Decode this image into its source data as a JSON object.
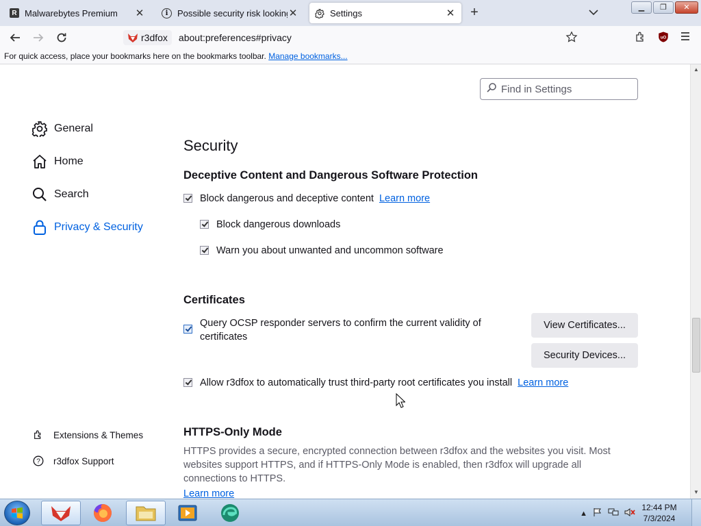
{
  "tabs": [
    {
      "title": "Malwarebytes Premium",
      "favicon": "malwarebytes-icon",
      "active": false
    },
    {
      "title": "Possible security risk looking up",
      "favicon": "info-icon",
      "active": false
    },
    {
      "title": "Settings",
      "favicon": "gear-icon",
      "active": true
    }
  ],
  "nav": {
    "identity_label": "r3dfox",
    "url": "about:preferences#privacy"
  },
  "bookmarks_bar": {
    "message": "For quick access, place your bookmarks here on the bookmarks toolbar.",
    "manage_link": "Manage bookmarks..."
  },
  "search": {
    "placeholder": "Find in Settings"
  },
  "sidebar": {
    "items": [
      {
        "label": "General",
        "icon": "gear-icon",
        "selected": false
      },
      {
        "label": "Home",
        "icon": "home-icon",
        "selected": false
      },
      {
        "label": "Search",
        "icon": "search-icon",
        "selected": false
      },
      {
        "label": "Privacy & Security",
        "icon": "lock-icon",
        "selected": true
      }
    ],
    "footer": [
      {
        "label": "Extensions & Themes",
        "icon": "puzzle-icon"
      },
      {
        "label": "r3dfox Support",
        "icon": "help-icon"
      }
    ]
  },
  "main": {
    "section_title": "Security",
    "deceptive": {
      "heading": "Deceptive Content and Dangerous Software Protection",
      "block_dangerous": {
        "label": "Block dangerous and deceptive content",
        "checked": true
      },
      "learn_more": "Learn more",
      "block_downloads": {
        "label": "Block dangerous downloads",
        "checked": true
      },
      "warn_unwanted": {
        "label": "Warn you about unwanted and uncommon software",
        "checked": true
      }
    },
    "certificates": {
      "heading": "Certificates",
      "ocsp": {
        "label": "Query OCSP responder servers to confirm the current validity of certificates",
        "checked": true
      },
      "view_button": "View Certificates...",
      "devices_button": "Security Devices...",
      "trust_roots": {
        "label": "Allow r3dfox to automatically trust third-party root certificates you install",
        "checked": true
      },
      "learn_more": "Learn more"
    },
    "https_only": {
      "heading": "HTTPS-Only Mode",
      "description": "HTTPS provides a secure, encrypted connection between r3dfox and the websites you visit. Most websites support HTTPS, and if HTTPS-Only Mode is enabled, then r3dfox will upgrade all connections to HTTPS.",
      "learn_more": "Learn more"
    }
  },
  "taskbar": {
    "time": "12:44 PM",
    "date": "7/3/2024",
    "apps": [
      "r3dfox-icon",
      "firefox-icon",
      "file-explorer-icon",
      "media-player-icon",
      "edge-icon"
    ]
  },
  "colors": {
    "accent": "#0061e0",
    "tabbar_bg": "#dfe4ef",
    "toolbar_bg": "#f9f9fb"
  }
}
